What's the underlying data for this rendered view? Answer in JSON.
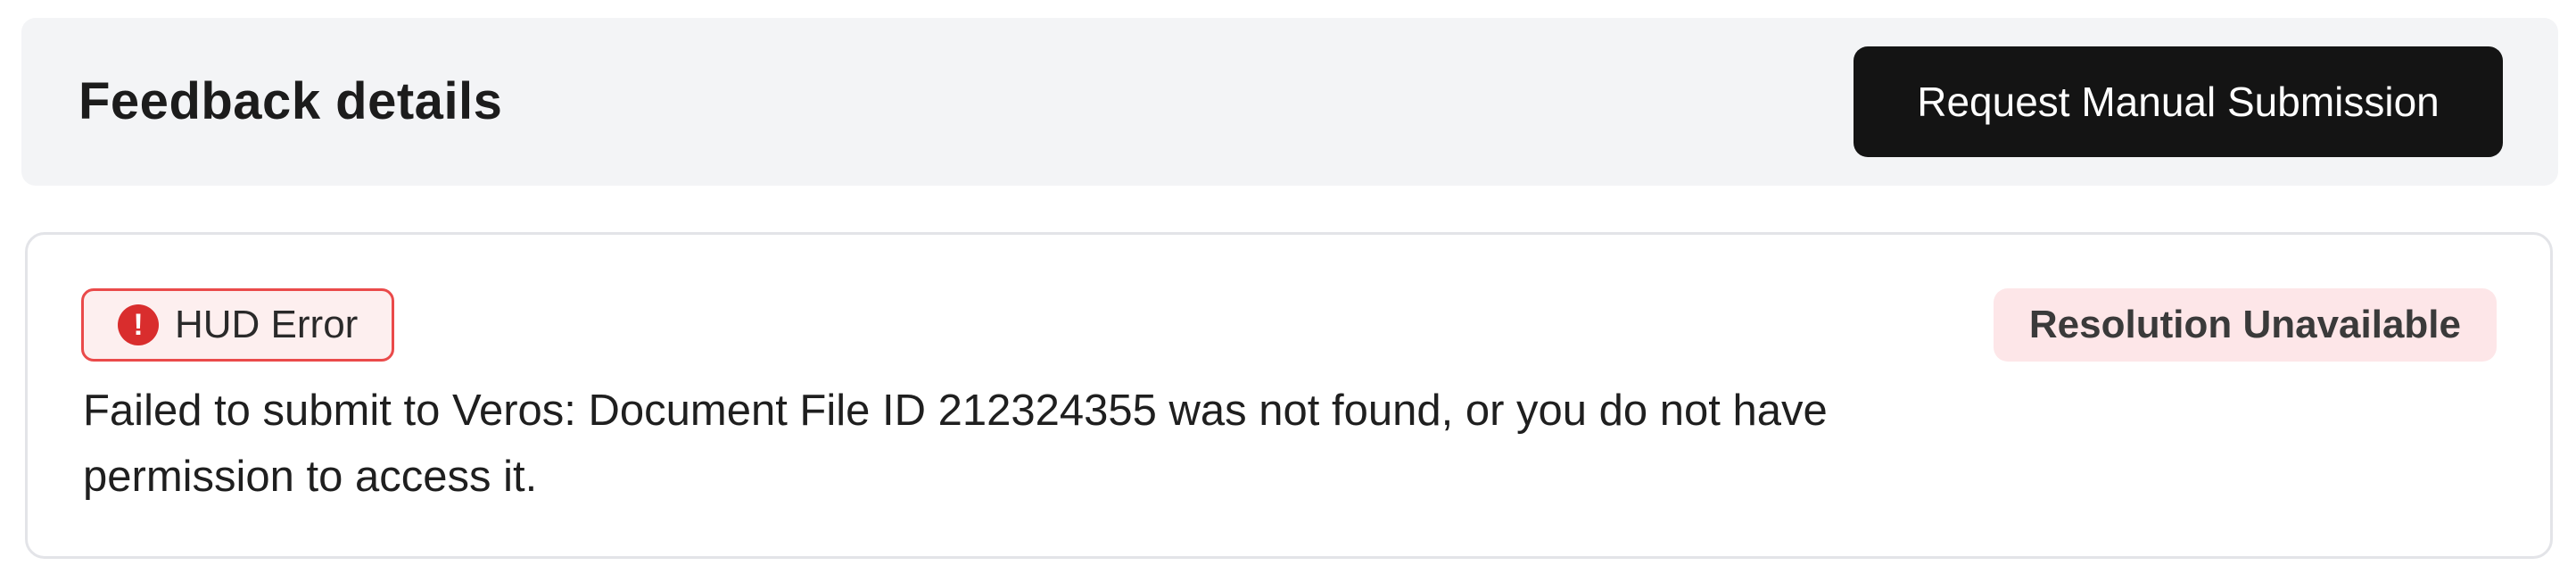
{
  "header": {
    "title": "Feedback details",
    "request_button_label": "Request Manual Submission"
  },
  "feedback": {
    "error_badge": {
      "icon": "exclamation-circle-icon",
      "icon_glyph": "!",
      "label": "HUD Error",
      "color": "#d92d2d"
    },
    "resolution_badge": {
      "label": "Resolution Unavailable"
    },
    "message": "Failed to submit to Veros: Document File ID 212324355 was not found, or you do not have permission to access it."
  },
  "colors": {
    "header_background": "#f3f4f6",
    "primary_button": "#141414",
    "error_border": "#ea4a4a",
    "error_background": "#fdefef",
    "resolution_background": "#fde6e8"
  }
}
